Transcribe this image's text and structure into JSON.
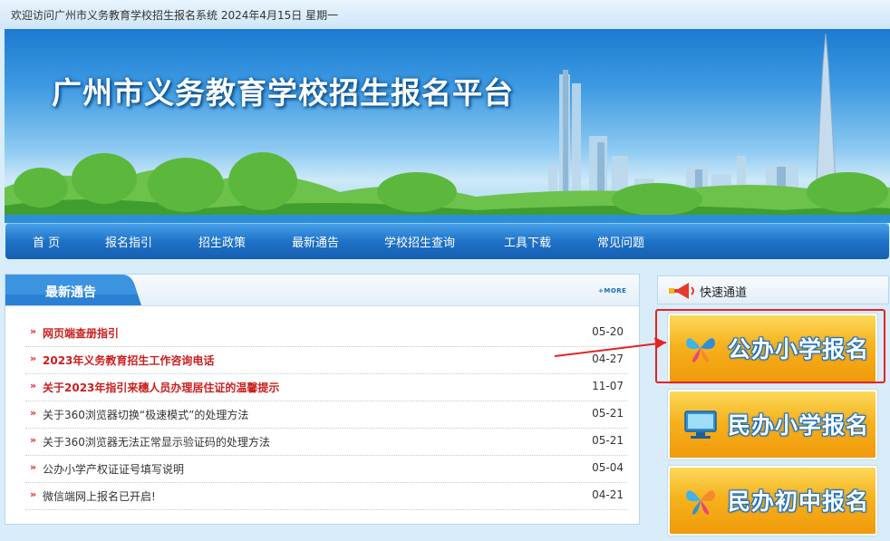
{
  "topbar": {
    "welcome": "欢迎访问广州市义务教育学校招生报名系统 2024年4月15日 星期一"
  },
  "banner": {
    "title": "广州市义务教育学校招生报名平台"
  },
  "nav": {
    "items": [
      {
        "label": "首 页"
      },
      {
        "label": "报名指引"
      },
      {
        "label": "招生政策"
      },
      {
        "label": "最新通告"
      },
      {
        "label": "学校招生查询"
      },
      {
        "label": "工具下载"
      },
      {
        "label": "常见问题"
      }
    ]
  },
  "notice": {
    "title": "最新通告",
    "more": "+MORE",
    "bullet": "»",
    "items": [
      {
        "title": "网页端查册指引",
        "date": "05-20",
        "hot": true
      },
      {
        "title": "2023年义务教育招生工作咨询电话",
        "date": "04-27",
        "hot": true
      },
      {
        "title": "关于2023年指引来穗人员办理居住证的温馨提示",
        "date": "11-07",
        "hot": true
      },
      {
        "title": "关于360浏览器切换“极速模式”的处理方法",
        "date": "05-21",
        "hot": false
      },
      {
        "title": "关于360浏览器无法正常显示验证码的处理方法",
        "date": "05-21",
        "hot": false
      },
      {
        "title": "公办小学产权证证号填写说明",
        "date": "05-04",
        "hot": false
      },
      {
        "title": "微信端网上报名已开启!",
        "date": "04-21",
        "hot": false
      }
    ]
  },
  "quick": {
    "title": "快速通道",
    "buttons": [
      {
        "label": "公办小学报名",
        "icon": "butterfly-icon"
      },
      {
        "label": "民办小学报名",
        "icon": "computer-icon"
      },
      {
        "label": "民办初中报名",
        "icon": "butterfly-icon"
      }
    ]
  },
  "colors": {
    "nav": "#1f73c8",
    "hot_text": "#cc1e1e",
    "button": "#f7b21e",
    "highlight": "#e32424"
  }
}
